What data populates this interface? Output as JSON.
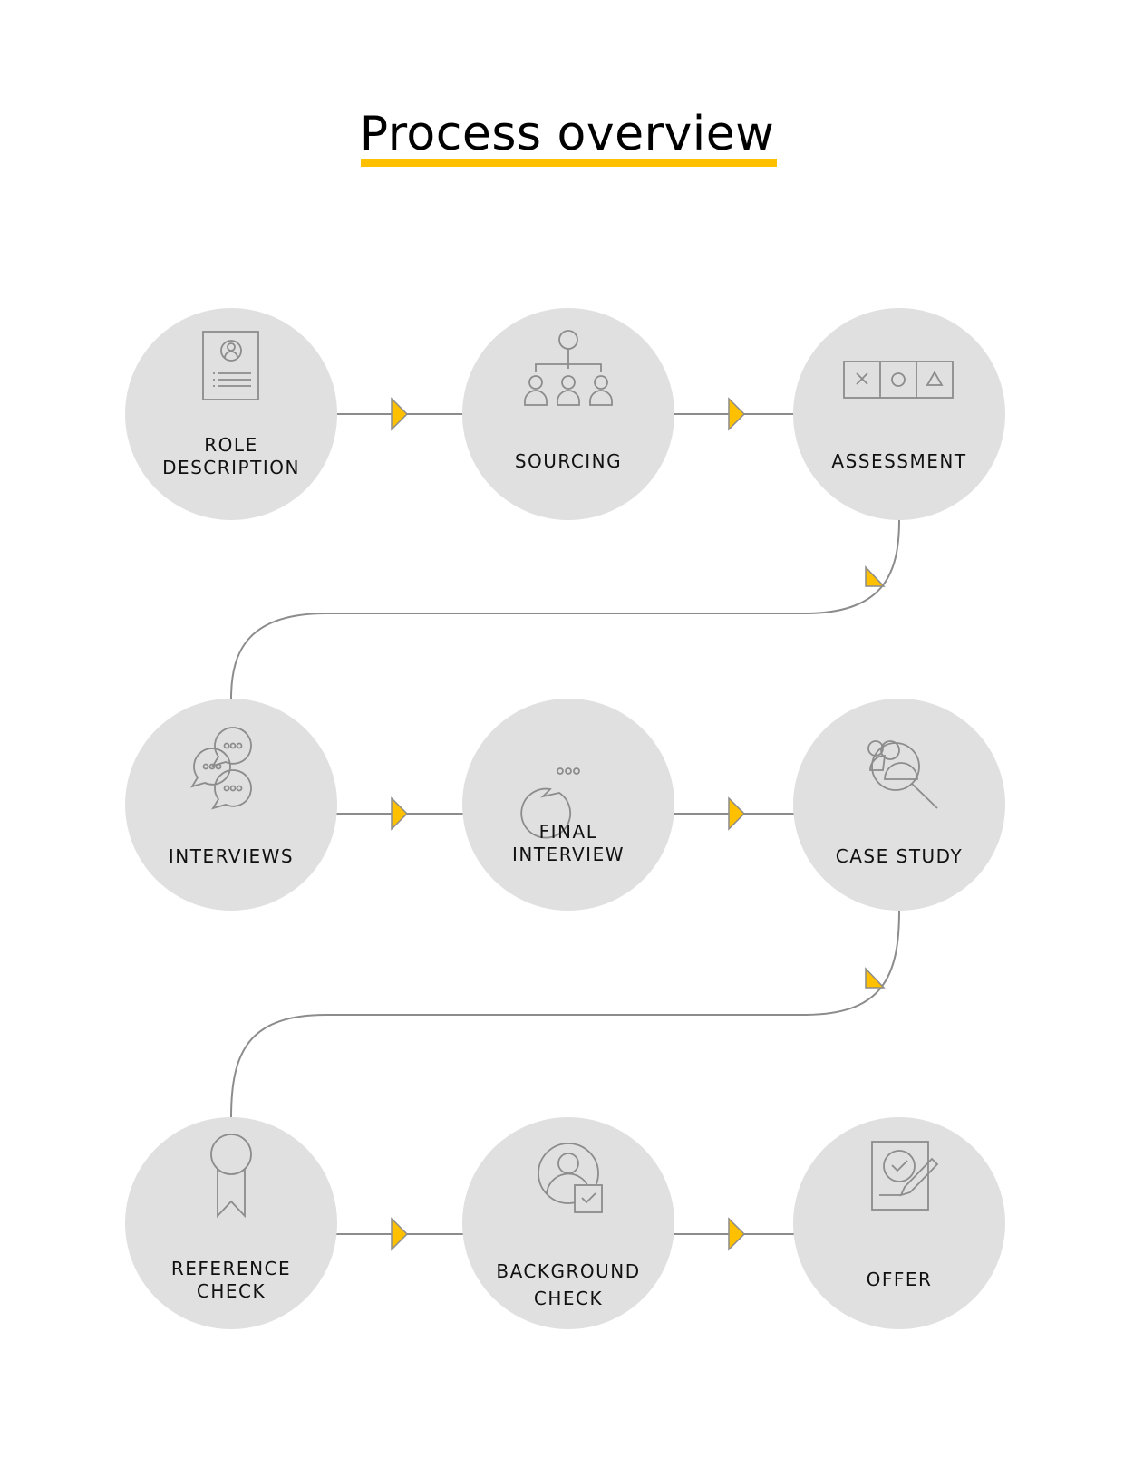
{
  "page": {
    "title": "Process overview",
    "accent_color": "#FFC000",
    "circle_color": "#E0E0E0",
    "line_color": "#8C8C8C"
  },
  "steps": [
    {
      "id": "role-description",
      "label_lines": [
        "ROLE",
        "DESCRIPTION"
      ],
      "icon": "resume-document-icon"
    },
    {
      "id": "sourcing",
      "label_lines": [
        "SOURCING"
      ],
      "icon": "org-hierarchy-icon"
    },
    {
      "id": "assessment",
      "label_lines": [
        "ASSESSMENT"
      ],
      "icon": "x-circle-triangle-boxes-icon"
    },
    {
      "id": "interviews",
      "label_lines": [
        "INTERVIEWS"
      ],
      "icon": "multiple-speech-bubbles-icon"
    },
    {
      "id": "final-interview",
      "label_lines": [
        "FINAL",
        "INTERVIEW"
      ],
      "icon": "speech-bubble-icon"
    },
    {
      "id": "case-study",
      "label_lines": [
        "CASE STUDY"
      ],
      "icon": "magnifier-people-icon"
    },
    {
      "id": "reference-check",
      "label_lines": [
        "REFERENCE",
        "CHECK"
      ],
      "icon": "award-ribbon-icon"
    },
    {
      "id": "background-check",
      "label_lines": [
        "BACKGROUND",
        "CHECK"
      ],
      "icon": "person-checkbox-icon"
    },
    {
      "id": "offer",
      "label_lines": [
        "OFFER"
      ],
      "icon": "signed-document-icon"
    }
  ]
}
